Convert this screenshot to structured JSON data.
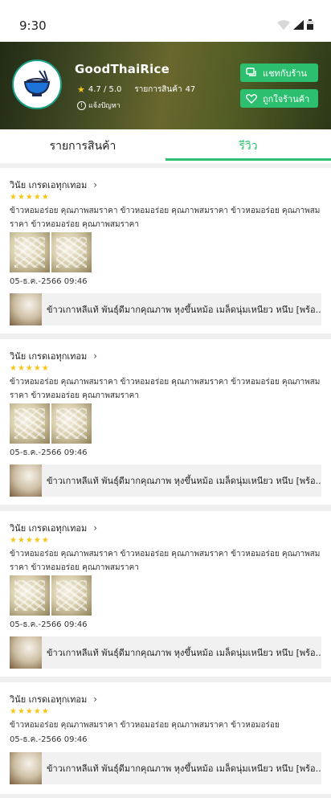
{
  "status_bar": {
    "time": "9:30"
  },
  "shop": {
    "name": "GoodThaiRice",
    "rating": "4.7 / 5.0",
    "products_label": "รายการสินค้า",
    "products_count": "47",
    "report_label": "แจ้งปัญหา",
    "chat_button": "แชทกับร้าน",
    "favorite_button": "ถูกใจร้านค้า"
  },
  "tabs": [
    {
      "label": "รายการสินค้า",
      "active": false
    },
    {
      "label": "รีวิว",
      "active": true
    }
  ],
  "colors": {
    "accent": "#2bbf6f",
    "star": "#f5c518"
  },
  "reviews": [
    {
      "reviewer": "วินัย เกรดเอทุกเทอม",
      "stars": "★★★★★",
      "text": "ข้าวหอมอร่อย คุณภาพสมราคา ข้าวหอมอร่อย คุณภาพสมราคา ข้าวหอมอร่อย คุณภาพสมราคา ข้าวหอมอร่อย คุณภาพสมราคา",
      "date": "05-ธ.ค.-2566  09:46",
      "product": "ข้าวเกาหลีแท้ พันธุ์ดีมากคุณภาพ หุงขึ้นหม้อ  เมล็ดนุ่มเหนียว หนึบ [พร้อ..."
    },
    {
      "reviewer": "วินัย เกรดเอทุกเทอม",
      "stars": "★★★★★",
      "text": "ข้าวหอมอร่อย คุณภาพสมราคา ข้าวหอมอร่อย คุณภาพสมราคา ข้าวหอมอร่อย คุณภาพสมราคา ข้าวหอมอร่อย คุณภาพสมราคา",
      "date": "05-ธ.ค.-2566  09:46",
      "product": "ข้าวเกาหลีแท้ พันธุ์ดีมากคุณภาพ หุงขึ้นหม้อ  เมล็ดนุ่มเหนียว หนึบ [พร้อ..."
    },
    {
      "reviewer": "วินัย เกรดเอทุกเทอม",
      "stars": "★★★★★",
      "text": "ข้าวหอมอร่อย คุณภาพสมราคา ข้าวหอมอร่อย คุณภาพสมราคา ข้าวหอมอร่อย คุณภาพสมราคา ข้าวหอมอร่อย คุณภาพสมราคา",
      "date": "05-ธ.ค.-2566  09:46",
      "product": "ข้าวเกาหลีแท้ พันธุ์ดีมากคุณภาพ หุงขึ้นหม้อ  เมล็ดนุ่มเหนียว หนึบ [พร้อ..."
    },
    {
      "reviewer": "วินัย เกรดเอทุกเทอม",
      "stars": "★★★★★",
      "text": "ข้าวหอมอร่อย คุณภาพสมราคา ข้าวหอมอร่อย คุณภาพสมราคา ข้าวหอมอร่อย",
      "date": "05-ธ.ค.-2566  09:46",
      "product": "ข้าวเกาหลีแท้ พันธุ์ดีมากคุณภาพ หุงขึ้นหม้อ  เมล็ดนุ่มเหนียว หนึบ [พร้อ..."
    }
  ]
}
